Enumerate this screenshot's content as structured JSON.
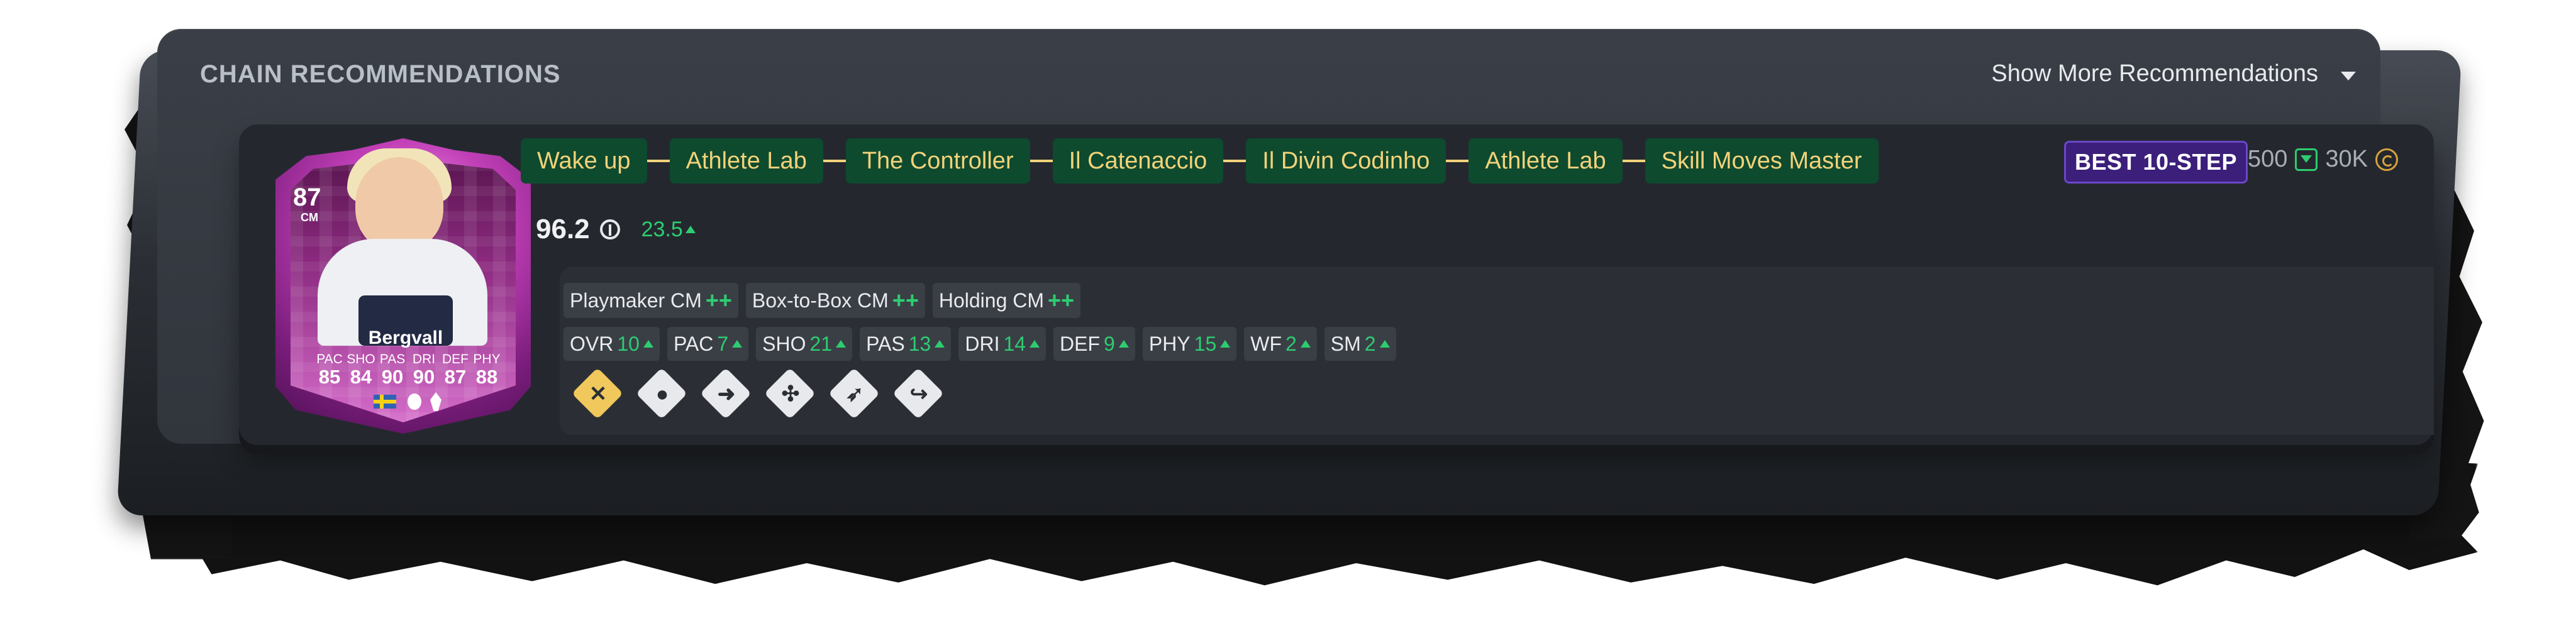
{
  "header": {
    "title": "CHAIN RECOMMENDATIONS",
    "more_label": "Show More Recommendations",
    "more_icon": "chevron-down-icon"
  },
  "player": {
    "rating": "87",
    "position": "CM",
    "name": "Bergvall",
    "stat_labels": [
      "PAC",
      "SHO",
      "PAS",
      "DRI",
      "DEF",
      "PHY"
    ],
    "stat_values": [
      "85",
      "84",
      "90",
      "90",
      "87",
      "88"
    ],
    "nation_icon": "sweden-flag-icon",
    "league_icon": "premier-league-icon",
    "club_icon": "tottenham-icon"
  },
  "chain": [
    "Wake up",
    "Athlete Lab",
    "The Controller",
    "Il Catenaccio",
    "Il Divin Codinho",
    "Athlete Lab",
    "Skill Moves Master"
  ],
  "best_label": "BEST 10-STEP",
  "cost": {
    "tokens": "500",
    "coins": "30K"
  },
  "score": {
    "value": "96.2",
    "delta": "23.5"
  },
  "roles": [
    {
      "name": "Playmaker CM",
      "plus": "++"
    },
    {
      "name": "Box-to-Box CM",
      "plus": "++"
    },
    {
      "name": "Holding CM",
      "plus": "++"
    }
  ],
  "stat_gains": [
    {
      "label": "OVR",
      "value": "10"
    },
    {
      "label": "PAC",
      "value": "7"
    },
    {
      "label": "SHO",
      "value": "21"
    },
    {
      "label": "PAS",
      "value": "13"
    },
    {
      "label": "DRI",
      "value": "14"
    },
    {
      "label": "DEF",
      "value": "9"
    },
    {
      "label": "PHY",
      "value": "15"
    },
    {
      "label": "WF",
      "value": "2"
    },
    {
      "label": "SM",
      "value": "2"
    }
  ],
  "playstyles": [
    "tactical-playstyle-icon",
    "location-playstyle-icon",
    "pass-playstyle-icon",
    "arrows-playstyle-icon",
    "runner-playstyle-icon",
    "flick-playstyle-icon"
  ],
  "colors": {
    "accent_green": "#2ecc71",
    "chip_bg": "#0e4a2e",
    "chip_text": "#f2d27a",
    "best_bg": "#3b1f7a"
  }
}
